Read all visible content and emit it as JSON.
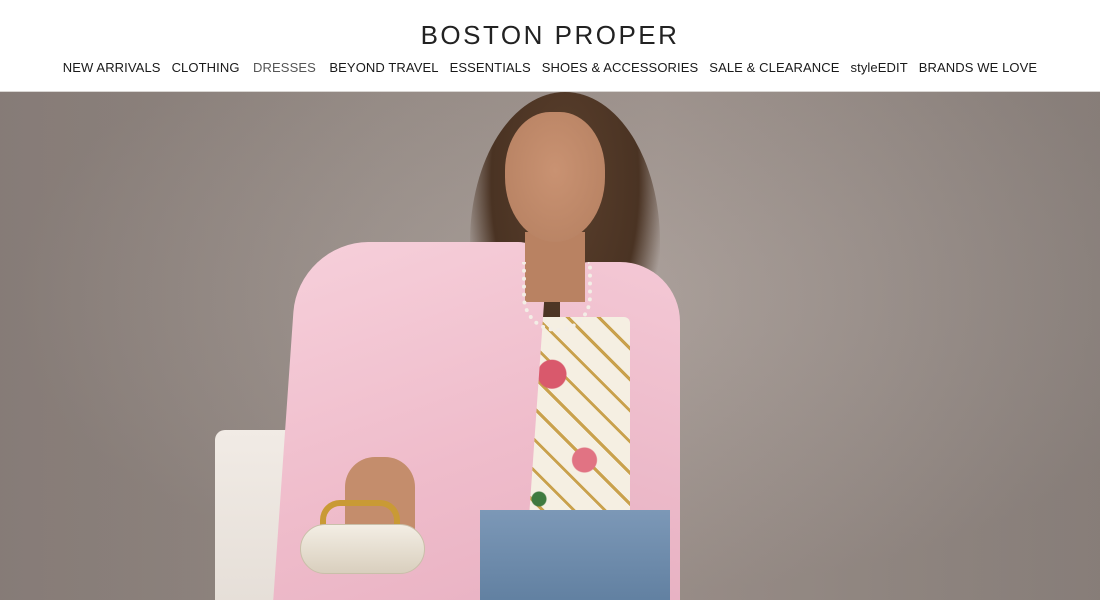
{
  "header": {
    "logo": "BOSTON PROPER"
  },
  "nav": {
    "items": [
      {
        "label": "NEW ARRIVALS"
      },
      {
        "label": "CLOTHING"
      },
      {
        "label": "DRESSES"
      },
      {
        "label": "BEYOND TRAVEL"
      },
      {
        "label": "ESSENTIALS"
      },
      {
        "label": "SHOES & ACCESSORIES"
      },
      {
        "label": "SALE & CLEARANCE"
      },
      {
        "label": "styleEDIT"
      },
      {
        "label": "BRANDS WE LOVE"
      }
    ]
  },
  "hero": {
    "image": "model-pink-blazer-photo"
  },
  "colors": {
    "background": "#ffffff",
    "text": "#1a1a1a",
    "hero_backdrop": "#9a8f89",
    "blazer": "#f2c4d1"
  }
}
